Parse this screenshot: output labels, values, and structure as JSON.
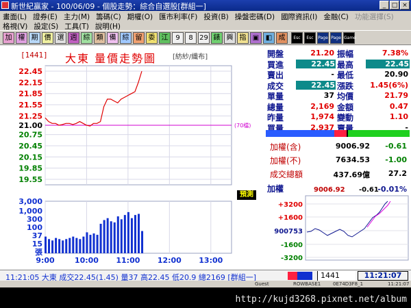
{
  "window": {
    "title": "新世紀贏家 - 100/06/09 - 個股走勢：綜合自選股[群組一]",
    "buttons": [
      "_",
      "□",
      "×"
    ]
  },
  "menu": {
    "row1": [
      {
        "label": "畫面(L)",
        "enabled": true
      },
      {
        "label": "證券(E)",
        "enabled": true
      },
      {
        "label": "主力(M)",
        "enabled": true
      },
      {
        "label": "籌碼(C)",
        "enabled": true
      },
      {
        "label": "期權(O)",
        "enabled": true
      },
      {
        "label": "匯市利率(F)",
        "enabled": true
      },
      {
        "label": "投資(B)",
        "enabled": true
      },
      {
        "label": "操盤密碼(D)",
        "enabled": true
      },
      {
        "label": "國際資訊(I)",
        "enabled": true
      },
      {
        "label": "金融(C)",
        "enabled": true
      },
      {
        "label": "功能選擇(S)",
        "enabled": false
      }
    ],
    "row2": [
      {
        "label": "格視(V)",
        "enabled": true
      },
      {
        "label": "設定(S)",
        "enabled": true
      },
      {
        "label": "工具(T)",
        "enabled": true
      },
      {
        "label": "說明(H)",
        "enabled": true
      }
    ]
  },
  "toolbar": [
    {
      "label": "加",
      "bg": "#e7a0d0"
    },
    {
      "label": "權",
      "bg": "#e0a0e0"
    },
    {
      "label": "期",
      "bg": "#b8d8f8"
    },
    {
      "label": "價",
      "bg": "#f0f0a0"
    },
    {
      "label": "選",
      "bg": "#e0e0e0"
    },
    {
      "label": "週",
      "bg": "#c060c0"
    },
    {
      "label": "綜",
      "bg": "#a0e0a0"
    },
    {
      "label": "類",
      "bg": "#e0c0a0"
    },
    {
      "label": "備",
      "bg": "#f0c0f0"
    },
    {
      "label": "綜",
      "bg": "#a0c8ff"
    },
    {
      "label": "留",
      "bg": "#f0a070"
    },
    {
      "label": "委",
      "bg": "#f0e070"
    },
    {
      "label": "江",
      "bg": "#60c060"
    },
    {
      "label": "9",
      "bg": "#f0f0f0"
    },
    {
      "label": "8",
      "bg": "#f0f0f0"
    },
    {
      "label": "29",
      "bg": "#f0f0f0"
    },
    {
      "label": "錶",
      "bg": "#70d070"
    },
    {
      "label": "興",
      "bg": "#e0e0e0"
    },
    {
      "label": "指",
      "bg": "#f0e090"
    },
    {
      "label": "▣",
      "bg": "#b070d0"
    },
    {
      "label": "◧",
      "bg": "#70b0e0"
    },
    {
      "label": "成",
      "bg": "#e09060"
    },
    {
      "label": "Esc",
      "bg": "#000"
    },
    {
      "label": "Esc",
      "bg": "#000"
    },
    {
      "label": "Page",
      "bg": "#103080"
    },
    {
      "label": "Page",
      "bg": "#103080"
    },
    {
      "label": "Game",
      "bg": "#000"
    }
  ],
  "stock": {
    "code": "[1441]",
    "title": "大東 量價走勢圖",
    "category": "[紡紗/纖布]"
  },
  "price_axis": [
    "22.45",
    "22.15",
    "21.85",
    "21.55",
    "21.25",
    "21.00",
    "20.75",
    "20.45",
    "20.15",
    "19.85",
    "19.55"
  ],
  "volume_axis": [
    "3,000",
    "1,000",
    "300",
    "100",
    "37",
    "15",
    "張"
  ],
  "time_axis": [
    "9:00",
    "10:00",
    "11:00",
    "12:00",
    "13:00"
  ],
  "ref_label": "(70檔)",
  "pv_label": "預測",
  "colors": {
    "up": "#e00000",
    "down": "#008000",
    "flat": "#000000",
    "accent_blue": "#1030d0",
    "teal": "#0d8a8a",
    "magenta": "#d000d0"
  },
  "quote": {
    "left": [
      {
        "label": "開盤",
        "value": "21.20",
        "color": "#e00000",
        "hl": false
      },
      {
        "label": "買進",
        "value": "22.45",
        "color": "#fff",
        "hl": true
      },
      {
        "label": "賣出",
        "value": "-",
        "color": "#000",
        "hl": false
      },
      {
        "label": "成交",
        "value": "22.45",
        "color": "#fff",
        "hl": true
      },
      {
        "label": "單量",
        "value": "37",
        "color": "#000",
        "hl": false
      },
      {
        "label": "總量",
        "value": "2,169",
        "color": "#e00000",
        "hl": false
      },
      {
        "label": "昨量",
        "value": "1,974",
        "color": "#e00000",
        "hl": false
      },
      {
        "label": "買量",
        "value": "2,937",
        "color": "#e00000",
        "hl": false
      }
    ],
    "right": [
      {
        "label": "振幅",
        "value": "7.38%",
        "color": "#e00000",
        "hl": false
      },
      {
        "label": "最高",
        "value": "22.45",
        "color": "#fff",
        "hl": true
      },
      {
        "label": "最低",
        "value": "20.90",
        "color": "#000",
        "hl": false
      },
      {
        "label": "漲跌",
        "value": "1.45(6%)",
        "color": "#e00000",
        "hl": false
      },
      {
        "label": "均價",
        "value": "21.79",
        "color": "#e00000",
        "hl": false
      },
      {
        "label": "金額",
        "value": "0.47",
        "color": "#e00000",
        "hl": false
      },
      {
        "label": "變動",
        "value": "1.10",
        "color": "#e00000",
        "hl": false
      },
      {
        "label": "賣量",
        "value": "-",
        "color": "#000",
        "hl": false
      }
    ]
  },
  "index": [
    {
      "label": "加權(含)",
      "value": "9006.92",
      "change": "-0.61"
    },
    {
      "label": "加權(不)",
      "value": "7634.53",
      "change": "-1.00"
    },
    {
      "label": "成交總額",
      "value": "437.69億",
      "change": "27.2"
    }
  ],
  "mini": {
    "label": "加權",
    "value": "9006.92",
    "change": "-0.61",
    "pct": "-0.01%",
    "axis": [
      "+3200",
      "+1600",
      "900753",
      "-1600",
      "-3200"
    ]
  },
  "status": {
    "text": "11:21:05 大東 成交22.45(1.45) 量37 高22.45 低20.9 總2169 [群組一]",
    "code_input": "1441",
    "clock": "11:21:07"
  },
  "info_strip": [
    "Guest",
    "ROWBASE1",
    "0E74D3F8_1",
    "11:21:07"
  ],
  "footer": {
    "url": "http://kujd3268.pixnet.net/album"
  },
  "chart_data": {
    "type": "line",
    "title": "大東 量價走勢圖",
    "ylim": [
      19.55,
      22.45
    ],
    "ref_price": 21.0,
    "x": [
      "9:00",
      "9:05",
      "9:10",
      "9:15",
      "9:20",
      "9:25",
      "9:30",
      "9:35",
      "9:40",
      "9:45",
      "9:50",
      "9:55",
      "10:00",
      "10:05",
      "10:10",
      "10:15",
      "10:20",
      "10:25",
      "10:30",
      "10:35",
      "10:40",
      "10:45",
      "10:50",
      "10:55",
      "11:00",
      "11:05",
      "11:10",
      "11:15",
      "11:20"
    ],
    "series": [
      {
        "values": [
          21.2,
          21.1,
          21.05,
          21.05,
          21.0,
          21.02,
          21.05,
          21.05,
          21.02,
          21.05,
          21.1,
          21.05,
          21.0,
          20.98,
          21.05,
          21.05,
          21.1,
          21.5,
          21.7,
          21.7,
          21.65,
          21.6,
          21.7,
          21.75,
          21.8,
          21.85,
          21.9,
          22.15,
          22.45
        ]
      }
    ],
    "volume": [
      15,
      10,
      8,
      12,
      10,
      8,
      10,
      12,
      15,
      12,
      10,
      15,
      30,
      20,
      25,
      20,
      120,
      220,
      300,
      180,
      150,
      400,
      250,
      500,
      800,
      300,
      500,
      600,
      37
    ]
  }
}
